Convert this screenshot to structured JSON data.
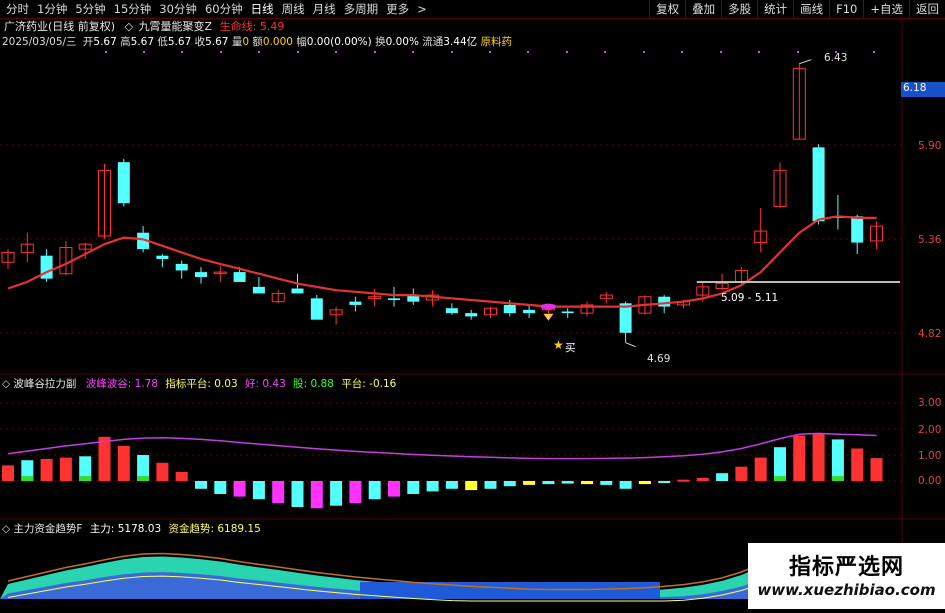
{
  "toolbar": {
    "periods": [
      "分时",
      "1分钟",
      "5分钟",
      "15分钟",
      "30分钟",
      "60分钟",
      "日线",
      "周线",
      "月线",
      "多周期",
      "更多"
    ],
    "active_period": "日线",
    "buttons": [
      "复权",
      "叠加",
      "多股",
      "统计",
      "画线",
      "F10",
      "+自选",
      "返回"
    ],
    "gear_symbol": "◇",
    "more_symbol": ">"
  },
  "header": {
    "stock_name": "广济药业(日线 前复权)",
    "indicator_name": "九霄量能聚变Z",
    "lifeline_label": "生命线:",
    "lifeline_value": "5.49",
    "date": "2025/03/05/三",
    "open_label": "开",
    "open": "5.67",
    "high_label": "高",
    "high": "5.67",
    "low_label": "低",
    "low": "5.67",
    "close_label": "收",
    "close": "5.67",
    "vol_label": "量",
    "vol": "0",
    "amount_label": "额",
    "amount": "0.000",
    "change_label": "幅",
    "change": "0.00(0.00%)",
    "turnover_label": "换",
    "turnover": "0.00%",
    "float_label": "流通",
    "float": "3.44亿",
    "concept": "原料药"
  },
  "main_chart": {
    "price_axis": [
      "5.90",
      "5.36",
      "4.82"
    ],
    "current_price_tag": "6.18",
    "high_annotation": "6.43",
    "low_annotation": "4.69",
    "range_label": "5.09 - 5.11",
    "buy_label": "买",
    "buy_star": "★"
  },
  "panel2": {
    "title": "波峰谷拉力副",
    "f1_label": "波峰波谷:",
    "f1_value": "1.78",
    "f2_label": "指标平台:",
    "f2_value": "0.03",
    "f3_label": "好:",
    "f3_value": "0.43",
    "f4_label": "股:",
    "f4_value": "0.88",
    "f5_label": "平台:",
    "f5_value": "-0.16",
    "axis": [
      "3.00",
      "2.00",
      "1.00",
      "0.00"
    ]
  },
  "panel3": {
    "title": "主力资金趋势F",
    "f1_label": "主力:",
    "f1_value": "5178.03",
    "f2_label": "资金趋势:",
    "f2_value": "6189.15"
  },
  "watermark": {
    "title": "指标严选网",
    "url": "www.xuezhibiao.com"
  },
  "colors": {
    "up": "#ff3232",
    "down": "#54ffff",
    "ma": "#e53232",
    "bg": "#000000",
    "grid": "#5a0000"
  },
  "chart_data": {
    "type": "candlestick",
    "ylim": [
      4.6,
      6.55
    ],
    "candles": [
      {
        "o": 5.22,
        "h": 5.3,
        "l": 5.18,
        "c": 5.28
      },
      {
        "o": 5.28,
        "h": 5.4,
        "l": 5.22,
        "c": 5.33
      },
      {
        "o": 5.26,
        "h": 5.3,
        "l": 5.1,
        "c": 5.12
      },
      {
        "o": 5.15,
        "h": 5.35,
        "l": 5.14,
        "c": 5.31
      },
      {
        "o": 5.3,
        "h": 5.34,
        "l": 5.24,
        "c": 5.33
      },
      {
        "o": 5.38,
        "h": 5.82,
        "l": 5.36,
        "c": 5.78
      },
      {
        "o": 5.83,
        "h": 5.85,
        "l": 5.56,
        "c": 5.58
      },
      {
        "o": 5.4,
        "h": 5.44,
        "l": 5.28,
        "c": 5.3
      },
      {
        "o": 5.26,
        "h": 5.27,
        "l": 5.19,
        "c": 5.24
      },
      {
        "o": 5.21,
        "h": 5.23,
        "l": 5.12,
        "c": 5.17
      },
      {
        "o": 5.16,
        "h": 5.19,
        "l": 5.09,
        "c": 5.13
      },
      {
        "o": 5.16,
        "h": 5.2,
        "l": 5.1,
        "c": 5.16
      },
      {
        "o": 5.16,
        "h": 5.19,
        "l": 5.11,
        "c": 5.1
      },
      {
        "o": 5.07,
        "h": 5.13,
        "l": 5.05,
        "c": 5.03
      },
      {
        "o": 4.98,
        "h": 5.05,
        "l": 4.97,
        "c": 5.03
      },
      {
        "o": 5.06,
        "h": 5.15,
        "l": 5.04,
        "c": 5.03
      },
      {
        "o": 5.0,
        "h": 5.02,
        "l": 4.88,
        "c": 4.87
      },
      {
        "o": 4.9,
        "h": 4.95,
        "l": 4.84,
        "c": 4.93
      },
      {
        "o": 4.98,
        "h": 5.01,
        "l": 4.92,
        "c": 4.96
      },
      {
        "o": 5.0,
        "h": 5.06,
        "l": 4.95,
        "c": 5.01
      },
      {
        "o": 5.0,
        "h": 5.07,
        "l": 4.95,
        "c": 4.99
      },
      {
        "o": 5.02,
        "h": 5.06,
        "l": 4.96,
        "c": 4.98
      },
      {
        "o": 4.99,
        "h": 5.05,
        "l": 4.95,
        "c": 5.02
      },
      {
        "o": 4.94,
        "h": 4.97,
        "l": 4.9,
        "c": 4.91
      },
      {
        "o": 4.91,
        "h": 4.93,
        "l": 4.87,
        "c": 4.89
      },
      {
        "o": 4.9,
        "h": 4.95,
        "l": 4.88,
        "c": 4.94
      },
      {
        "o": 4.96,
        "h": 4.99,
        "l": 4.89,
        "c": 4.91
      },
      {
        "o": 4.93,
        "h": 4.96,
        "l": 4.88,
        "c": 4.91
      },
      {
        "o": 4.93,
        "h": 4.96,
        "l": 4.91,
        "c": 4.94
      },
      {
        "o": 4.92,
        "h": 4.94,
        "l": 4.88,
        "c": 4.91
      },
      {
        "o": 4.91,
        "h": 4.98,
        "l": 4.89,
        "c": 4.96
      },
      {
        "o": 5.0,
        "h": 5.04,
        "l": 4.97,
        "c": 5.02
      },
      {
        "o": 4.97,
        "h": 4.98,
        "l": 4.73,
        "c": 4.79
      },
      {
        "o": 4.91,
        "h": 5.02,
        "l": 4.9,
        "c": 5.01
      },
      {
        "o": 5.01,
        "h": 5.02,
        "l": 4.91,
        "c": 4.95
      },
      {
        "o": 4.96,
        "h": 4.99,
        "l": 4.94,
        "c": 4.98
      },
      {
        "o": 5.02,
        "h": 5.1,
        "l": 4.98,
        "c": 5.07
      },
      {
        "o": 5.06,
        "h": 5.15,
        "l": 5.05,
        "c": 5.09
      },
      {
        "o": 5.1,
        "h": 5.19,
        "l": 5.08,
        "c": 5.17
      },
      {
        "o": 5.34,
        "h": 5.55,
        "l": 5.28,
        "c": 5.41
      },
      {
        "o": 5.56,
        "h": 5.83,
        "l": 5.55,
        "c": 5.78
      },
      {
        "o": 5.97,
        "h": 6.43,
        "l": 5.97,
        "c": 6.4
      },
      {
        "o": 5.92,
        "h": 5.94,
        "l": 5.45,
        "c": 5.47
      },
      {
        "o": 5.5,
        "h": 5.63,
        "l": 5.42,
        "c": 5.49
      },
      {
        "o": 5.5,
        "h": 5.51,
        "l": 5.27,
        "c": 5.34
      },
      {
        "o": 5.35,
        "h": 5.47,
        "l": 5.3,
        "c": 5.44
      }
    ],
    "ma_lifeline": [
      5.06,
      5.1,
      5.16,
      5.21,
      5.27,
      5.33,
      5.37,
      5.36,
      5.32,
      5.28,
      5.24,
      5.21,
      5.18,
      5.15,
      5.12,
      5.09,
      5.07,
      5.05,
      5.04,
      5.03,
      5.02,
      5.02,
      5.01,
      5.0,
      4.99,
      4.98,
      4.97,
      4.96,
      4.95,
      4.95,
      4.95,
      4.95,
      4.95,
      4.96,
      4.97,
      4.98,
      5.0,
      5.03,
      5.08,
      5.16,
      5.28,
      5.4,
      5.48,
      5.5,
      5.49,
      5.49
    ],
    "osc_bars": [
      0.6,
      0.8,
      0.85,
      0.9,
      0.95,
      1.7,
      1.35,
      1.0,
      0.7,
      0.35,
      -0.3,
      -0.5,
      -0.6,
      -0.7,
      -0.85,
      -1.0,
      -1.05,
      -0.95,
      -0.85,
      -0.7,
      -0.6,
      -0.5,
      -0.4,
      -0.3,
      -0.35,
      -0.3,
      -0.2,
      -0.15,
      -0.12,
      -0.1,
      -0.12,
      -0.15,
      -0.3,
      -0.12,
      -0.05,
      0.05,
      0.12,
      0.3,
      0.55,
      0.9,
      1.3,
      1.75,
      1.85,
      1.6,
      1.25,
      0.88
    ],
    "osc_line": [
      1.05,
      1.15,
      1.25,
      1.35,
      1.43,
      1.52,
      1.6,
      1.65,
      1.66,
      1.64,
      1.6,
      1.55,
      1.48,
      1.42,
      1.36,
      1.3,
      1.24,
      1.19,
      1.14,
      1.1,
      1.06,
      1.02,
      0.99,
      0.96,
      0.93,
      0.91,
      0.89,
      0.87,
      0.86,
      0.86,
      0.86,
      0.87,
      0.88,
      0.9,
      0.93,
      0.97,
      1.03,
      1.12,
      1.25,
      1.43,
      1.63,
      1.8,
      1.83,
      1.8,
      1.78,
      1.75
    ]
  }
}
